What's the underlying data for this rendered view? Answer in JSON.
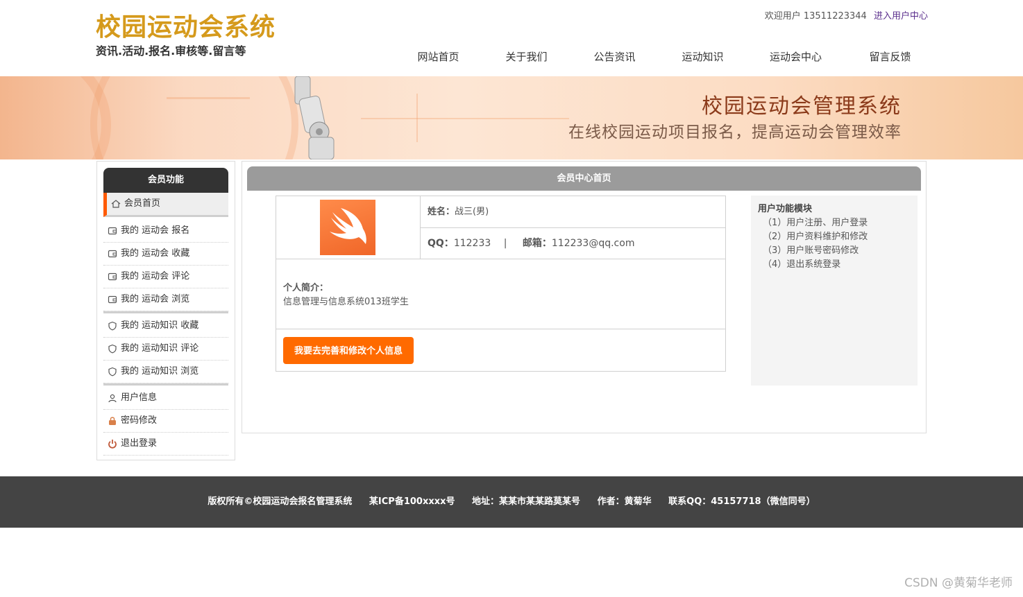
{
  "header": {
    "logo_title": "校园运动会系统",
    "logo_subtitle": "资讯.活动.报名.审核等.留言等",
    "welcome_text": "欢迎用户 13511223344",
    "user_center_link": "进入用户中心",
    "nav": [
      "网站首页",
      "关于我们",
      "公告资讯",
      "运动知识",
      "运动会中心",
      "留言反馈"
    ]
  },
  "banner": {
    "title": "校园运动会管理系统",
    "subtitle": "在线校园运动项目报名，提高运动会管理效率"
  },
  "sidebar": {
    "heading": "会员功能",
    "items": [
      {
        "label": "会员首页",
        "icon": "home-icon"
      },
      {
        "label": "我的 运动会 报名",
        "icon": "wallet-icon"
      },
      {
        "label": "我的 运动会 收藏",
        "icon": "wallet-icon"
      },
      {
        "label": "我的 运动会 评论",
        "icon": "wallet-icon"
      },
      {
        "label": "我的 运动会 浏览",
        "icon": "wallet-icon"
      },
      {
        "label": "我的 运动知识 收藏",
        "icon": "shield-icon"
      },
      {
        "label": "我的 运动知识 评论",
        "icon": "shield-icon"
      },
      {
        "label": "我的 运动知识 浏览",
        "icon": "shield-icon"
      },
      {
        "label": "用户信息",
        "icon": "user-icon"
      },
      {
        "label": "密码修改",
        "icon": "lock-icon"
      },
      {
        "label": "退出登录",
        "icon": "power-icon"
      }
    ]
  },
  "main": {
    "heading": "会员中心首页",
    "profile": {
      "name_label": "姓名：",
      "name_value": "战三(男)",
      "qq_label": "QQ：",
      "qq_value": "112233",
      "separator": "|",
      "email_label": "邮箱：",
      "email_value": "112233@qq.com",
      "intro_label": "个人简介：",
      "intro_value": "信息管理与信息系统013班学生",
      "edit_button": "我要去完善和修改个人信息"
    },
    "functions": {
      "title": "用户功能模块",
      "items": [
        "（1）用户注册、用户登录",
        "（2）用户资料维护和修改",
        "（3）用户账号密码修改",
        "（4）退出系统登录"
      ]
    }
  },
  "footer": {
    "copyright": "版权所有©校园运动会报名管理系统",
    "icp": "某ICP备100xxxx号",
    "address": "地址：某某市某某路莫某号",
    "author": "作者：黄菊华",
    "contact": "联系QQ：45157718（微信同号）"
  },
  "watermark": "CSDN @黄菊华老师",
  "colors": {
    "logo": "#d59a1c",
    "accent": "#ff6a00",
    "banner_title": "#8b3a1a",
    "sidebar_head": "#333333",
    "footer": "#444444"
  }
}
